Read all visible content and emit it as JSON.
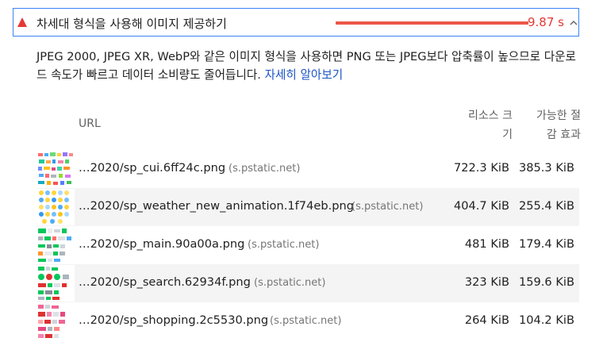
{
  "audit": {
    "title": "차세대 형식을 사용해 이미지 제공하기",
    "savings": "9.87 s",
    "savings_fraction": 1.0,
    "fail_color": "#e53935",
    "bar_color": "#ec5548",
    "chevron_icon": "chevron-up-icon"
  },
  "description": {
    "text": "JPEG 2000, JPEG XR, WebP와 같은 이미지 형식을 사용하면 PNG 또는 JPEG보다 압축률이 높으므로 다운로드 속도가 빠르고 데이터 소비량도 줄어듭니다. ",
    "link_text": "자세히 알아보기",
    "link_color": "#1a53c4"
  },
  "table": {
    "headers": {
      "url": "URL",
      "resource_size_line1": "리소스 크",
      "resource_size_line2": "기",
      "savings_line1": "가능한 절",
      "savings_line2": "감 효과"
    },
    "rows": [
      {
        "url": "…2020/sp_cui.6ff24c.png",
        "host": "(s.pstatic.net)",
        "size": "722.3 KiB",
        "savings": "385.3 KiB"
      },
      {
        "url": "…2020/sp_weather_new_animation.1f74eb.png",
        "host": "(s.pstatic.net)",
        "size": "404.7 KiB",
        "savings": "255.4 KiB"
      },
      {
        "url": "…2020/sp_main.90a00a.png",
        "host": "(s.pstatic.net)",
        "size": "481 KiB",
        "savings": "179.4 KiB"
      },
      {
        "url": "…2020/sp_search.62934f.png",
        "host": "(s.pstatic.net)",
        "size": "323 KiB",
        "savings": "159.6 KiB"
      },
      {
        "url": "…2020/sp_shopping.2c5530.png",
        "host": "(s.pstatic.net)",
        "size": "264 KiB",
        "savings": "104.2 KiB"
      }
    ]
  }
}
